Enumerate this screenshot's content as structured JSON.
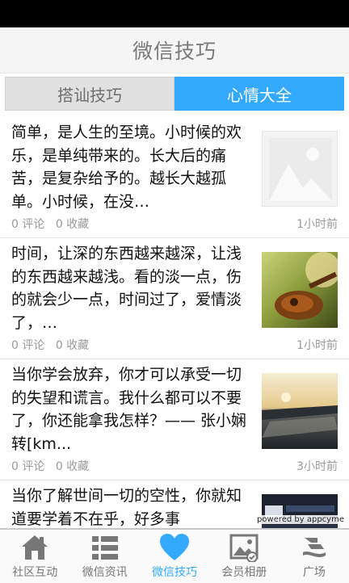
{
  "header": {
    "title": "微信技巧"
  },
  "tabs": [
    {
      "label": "搭讪技巧",
      "active": false
    },
    {
      "label": "心情大全",
      "active": true
    }
  ],
  "items": [
    {
      "text": "简单，是人生的至境。小时候的欢乐，是单纯带来的。长大后的痛苦，是复杂给予的。越长大越孤单。小时候，在没…",
      "comments": "0 评论",
      "favorites": "0 收藏",
      "time": "1小时前",
      "thumbnail": "placeholder-image-icon"
    },
    {
      "text": "时间，让深的东西越来越深，让浅的东西越来越浅。看的淡一点，伤的就会少一点，时间过了，爱情淡了，…",
      "comments": "0 评论",
      "favorites": "0 收藏",
      "time": "1小时前",
      "thumbnail": "photo-guitar-sunset"
    },
    {
      "text": "当你学会放弃，你才可以承受一切的失望和谎言。我什么都可以不要了，你还能拿我怎样？—— 张小娴  转[km...",
      "comments": "0 评论",
      "favorites": "0 收藏",
      "time": "3小时前",
      "thumbnail": "photo-river-sunset"
    },
    {
      "text": "当你了解世间一切的空性，你就知道要学着不在乎，好多事",
      "comments": "",
      "favorites": "",
      "time": "",
      "thumbnail": "photo-night-banner"
    }
  ],
  "watermark": "powered by appcyme",
  "bottom_nav": [
    {
      "label": "社区互动",
      "icon": "home-icon",
      "active": false
    },
    {
      "label": "微信资讯",
      "icon": "list-icon",
      "active": false
    },
    {
      "label": "微信技巧",
      "icon": "heart-icon",
      "active": true
    },
    {
      "label": "会员相册",
      "icon": "photo-album-icon",
      "active": false
    },
    {
      "label": "广场",
      "icon": "square-logo-icon",
      "active": false
    }
  ],
  "colors": {
    "accent": "#33aaff",
    "inactive_tab": "#e1e1e1",
    "nav_icon": "#777777"
  }
}
